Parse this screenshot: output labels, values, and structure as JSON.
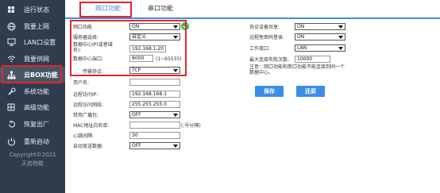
{
  "sidebar": {
    "items": [
      {
        "label": "运行状态",
        "icon": "dashboard-icon"
      },
      {
        "label": "我要上网",
        "icon": "globe-icon"
      },
      {
        "label": "LAN口设置",
        "icon": "monitor-icon"
      },
      {
        "label": "我要供网",
        "icon": "wifi-icon"
      },
      {
        "label": "云BOX功能",
        "icon": "network-tree-icon"
      },
      {
        "label": "系统功能",
        "icon": "wrench-icon"
      },
      {
        "label": "高级功能",
        "icon": "grid-icon"
      },
      {
        "label": "恢复出厂",
        "icon": "restore-icon"
      },
      {
        "label": "重新启动",
        "icon": "power-icon"
      }
    ],
    "copyright_line1": "Copyright©2021",
    "copyright_line2": "天启物联"
  },
  "tabs": [
    {
      "label": "网口功能"
    },
    {
      "label": "串口功能"
    }
  ],
  "form_left": {
    "net_function_label": "网口功能",
    "net_function_value": "ON",
    "server_select_label": "服务器选择:",
    "server_select_value": "自定义",
    "data_center_ip_label_1": "数据中心IP(或者域",
    "data_center_ip_label_2": "名):",
    "data_center_ip_value": "192.168.1.20",
    "data_center_port_label": "数据中心端口:",
    "data_center_port_value": "8000",
    "data_center_port_hint": "(1~65535)",
    "transport_label": "传输协议:",
    "transport_value": "TCP",
    "username_label": "用户名:",
    "username_value": "",
    "remote_ip_label": "远程访问IP:",
    "remote_ip_value": "192.168.168.1",
    "remote_mask_label": "远程访问网段:",
    "remote_mask_value": "255.255.255.0",
    "broadcast_label": "禁用广播包:",
    "broadcast_value": "OFF",
    "mac_whitelist_label": "MAC地址白名单:",
    "mac_whitelist_value": "",
    "mac_whitelist_hint": "(;号分隔)",
    "heartbeat_label": "心跳间隔:",
    "heartbeat_value": "30",
    "auto_reconnect_label": "自动发送数据:",
    "auto_reconnect_value": "OFF"
  },
  "form_right": {
    "share_label": "协议设备共享:",
    "share_value": "ON",
    "remote_login_label": "远程免密码登录:",
    "remote_login_value": "ON",
    "work_port_label": "工作接口:",
    "work_port_value": "LAN",
    "max_conn_label": "最大连接失败次数:",
    "max_conn_value": "10000",
    "note_line1": "注意：网口功能和串口功能不能连接到同一个",
    "note_line2": "数据中心。",
    "save_label": "保存",
    "restore_label": "还原"
  },
  "colors": {
    "sidebar_bg": "#2f3c4e",
    "active_bg": "#485565",
    "accent": "#3a8ee6",
    "highlight_red": "#e3262b",
    "check_green": "#2dbb4e"
  }
}
